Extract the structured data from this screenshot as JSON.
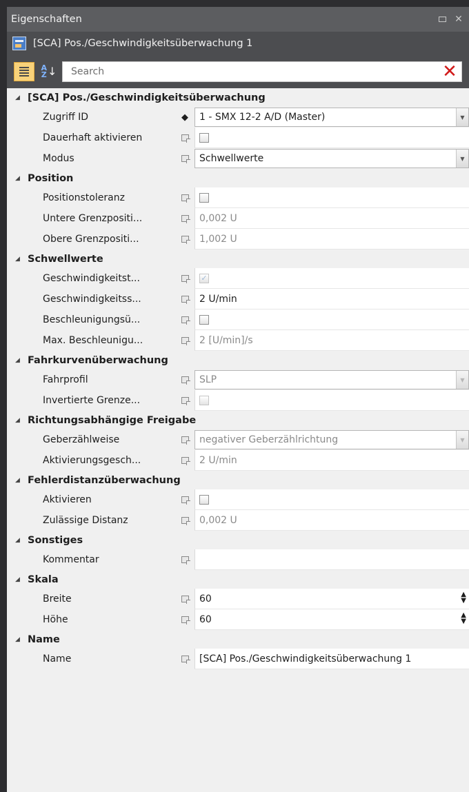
{
  "window": {
    "title": "Eigenschaften",
    "object_name": "[SCA] Pos./Geschwindigkeitsüberwachung 1"
  },
  "toolbar": {
    "search_placeholder": "Search"
  },
  "categories": [
    {
      "label": "[SCA] Pos./Geschwindigkeitsüberwachung",
      "props": [
        {
          "name": "Zugriff ID",
          "marker": "diamond",
          "kind": "combo",
          "value": "1 - SMX 12-2 A/D (Master)",
          "ro": false
        },
        {
          "name": "Dauerhaft aktivieren",
          "marker": "box",
          "kind": "check",
          "checked": false,
          "ro": false
        },
        {
          "name": "Modus",
          "marker": "box",
          "kind": "combo",
          "value": "Schwellwerte",
          "ro": false
        }
      ]
    },
    {
      "label": "Position",
      "props": [
        {
          "name": "Positionstoleranz",
          "marker": "box",
          "kind": "check",
          "checked": false,
          "ro": false
        },
        {
          "name": "Untere Grenzpositi...",
          "marker": "box",
          "kind": "text",
          "value": "0,002 U",
          "ro": true
        },
        {
          "name": "Obere Grenzpositi...",
          "marker": "box",
          "kind": "text",
          "value": "1,002 U",
          "ro": true
        }
      ]
    },
    {
      "label": "Schwellwerte",
      "props": [
        {
          "name": "Geschwindigkeitst...",
          "marker": "box",
          "kind": "check",
          "checked": true,
          "ro": true
        },
        {
          "name": "Geschwindigkeitss...",
          "marker": "box",
          "kind": "text",
          "value": "2 U/min",
          "ro": false
        },
        {
          "name": "Beschleunigungsü...",
          "marker": "box",
          "kind": "check",
          "checked": false,
          "ro": false
        },
        {
          "name": "Max. Beschleunigu...",
          "marker": "box",
          "kind": "text",
          "value": "2 [U/min]/s",
          "ro": true
        }
      ]
    },
    {
      "label": "Fahrkurvenüberwachung",
      "props": [
        {
          "name": "Fahrprofil",
          "marker": "box",
          "kind": "combo",
          "value": "SLP",
          "ro": true
        },
        {
          "name": "Invertierte Grenze...",
          "marker": "box",
          "kind": "check",
          "checked": false,
          "ro": true
        }
      ]
    },
    {
      "label": "Richtungsabhängige Freigabe",
      "props": [
        {
          "name": "Geberzählweise",
          "marker": "box",
          "kind": "combo",
          "value": "negativer Geberzählrichtung",
          "ro": true
        },
        {
          "name": "Aktivierungsgesch...",
          "marker": "box",
          "kind": "text",
          "value": "2 U/min",
          "ro": true
        }
      ]
    },
    {
      "label": "Fehlerdistanzüberwachung",
      "props": [
        {
          "name": "Aktivieren",
          "marker": "box",
          "kind": "check",
          "checked": false,
          "ro": false
        },
        {
          "name": "Zulässige Distanz",
          "marker": "box",
          "kind": "text",
          "value": "0,002 U",
          "ro": true
        }
      ]
    },
    {
      "label": "Sonstiges",
      "props": [
        {
          "name": "Kommentar",
          "marker": "box",
          "kind": "text",
          "value": "",
          "ro": false
        }
      ]
    },
    {
      "label": "Skala",
      "props": [
        {
          "name": "Breite",
          "marker": "box",
          "kind": "spin",
          "value": "60",
          "ro": false
        },
        {
          "name": "Höhe",
          "marker": "box",
          "kind": "spin",
          "value": "60",
          "ro": false
        }
      ]
    },
    {
      "label": "Name",
      "props": [
        {
          "name": "Name",
          "marker": "box",
          "kind": "text",
          "value": "[SCA] Pos./Geschwindigkeitsüberwachung 1",
          "ro": false
        }
      ]
    }
  ]
}
